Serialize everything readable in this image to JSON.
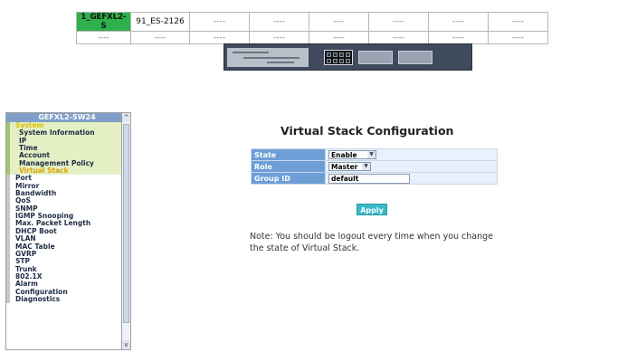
{
  "stack_table": {
    "row1": [
      "1_GEFXL2-S",
      "91_ES-2126",
      "----",
      "----",
      "----",
      "----",
      "----",
      "----"
    ],
    "row2": [
      "----",
      "----",
      "----",
      "----",
      "----",
      "----",
      "----",
      "----"
    ]
  },
  "nav": {
    "title": "GEFXL2-SW24",
    "items": [
      {
        "label": "System"
      },
      {
        "label": "System Information"
      },
      {
        "label": "IP"
      },
      {
        "label": "Time"
      },
      {
        "label": "Account"
      },
      {
        "label": "Management Policy"
      },
      {
        "label": "Virtual Stack"
      },
      {
        "label": "Port"
      },
      {
        "label": "Mirror"
      },
      {
        "label": "Bandwidth"
      },
      {
        "label": "QoS"
      },
      {
        "label": "SNMP"
      },
      {
        "label": "IGMP Snooping"
      },
      {
        "label": "Max. Packet Length"
      },
      {
        "label": "DHCP Boot"
      },
      {
        "label": "VLAN"
      },
      {
        "label": "MAC Table"
      },
      {
        "label": "GVRP"
      },
      {
        "label": "STP"
      },
      {
        "label": "Trunk"
      },
      {
        "label": "802.1X"
      },
      {
        "label": "Alarm"
      },
      {
        "label": "Configuration"
      },
      {
        "label": "Diagnostics"
      }
    ],
    "scroll_up": "^",
    "scroll_down": "v"
  },
  "main": {
    "title": "Virtual Stack Configuration",
    "fields": {
      "state_label": "State",
      "state_value": "Enable",
      "role_label": "Role",
      "role_value": "Master",
      "group_label": "Group ID",
      "group_value": "default"
    },
    "apply_label": "Apply",
    "note": "Note: You should be logout every time when you change the state of Virtual Stack."
  },
  "colors": {
    "active_unit": "#2eb04a",
    "label_bg": "#6d9ed6",
    "apply_bg": "#37b9c8",
    "nav_title": "#7f9fc8"
  }
}
